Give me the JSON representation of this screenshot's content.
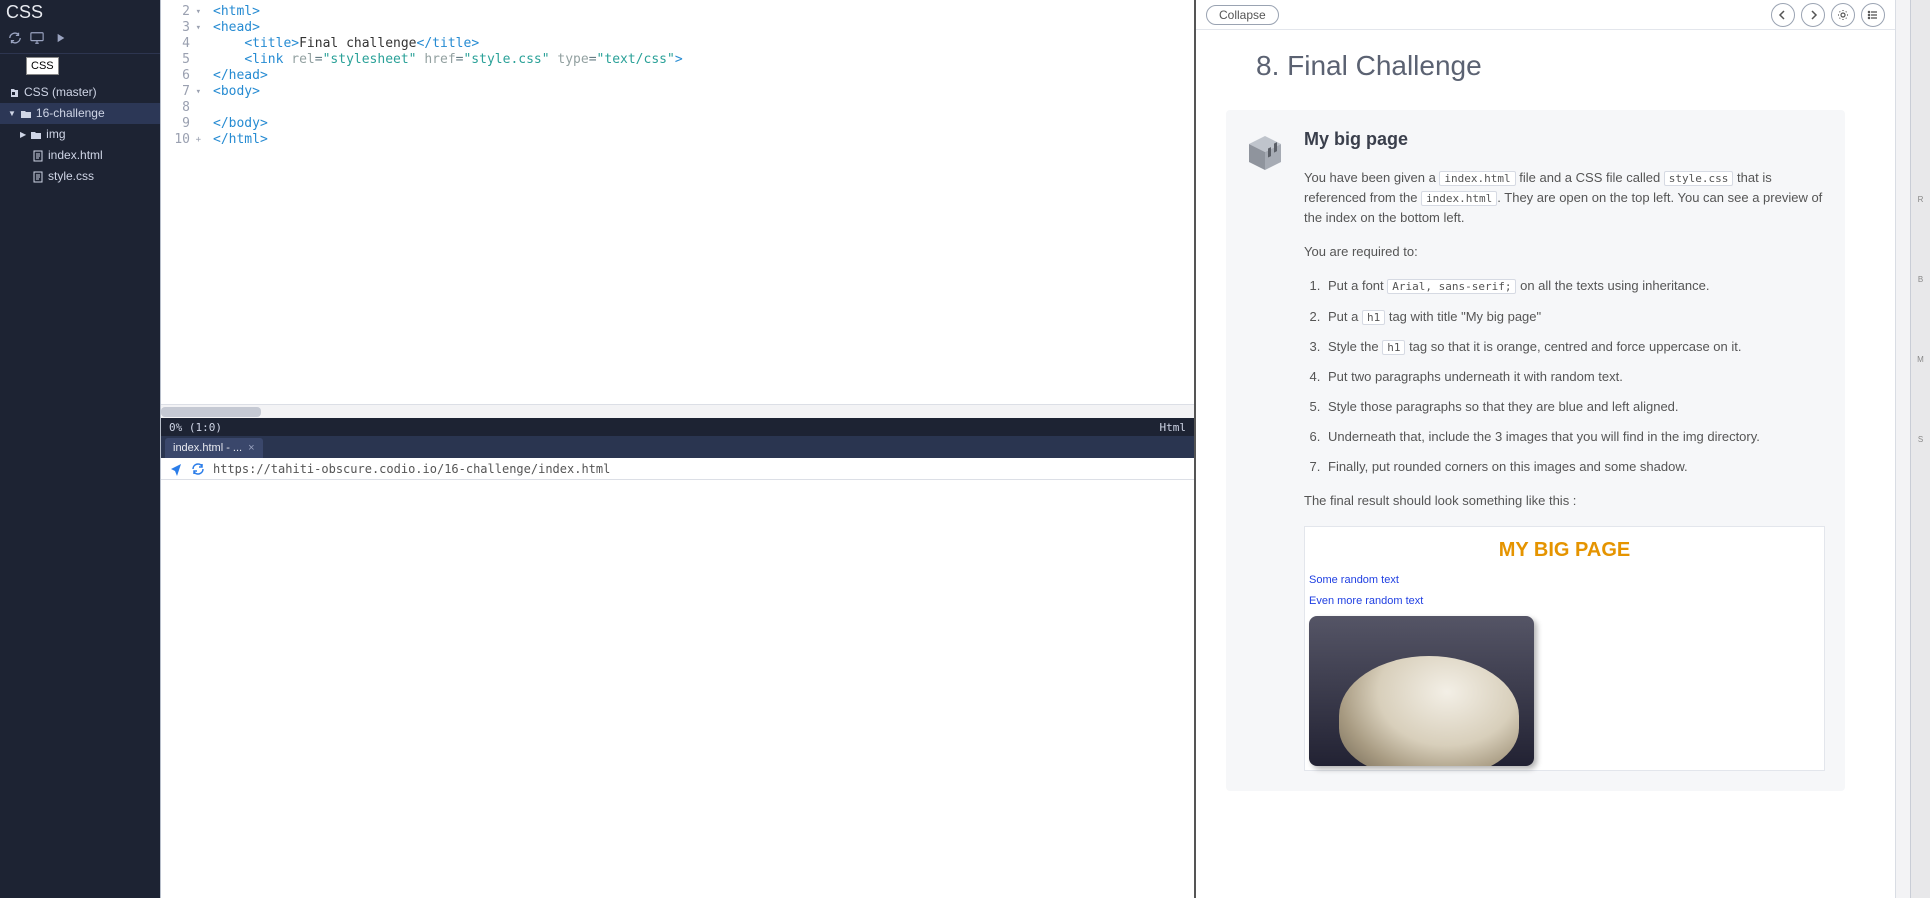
{
  "sidebar": {
    "title": "CSS",
    "tooltip": "CSS",
    "tree": {
      "root_label": "CSS (master)",
      "folder_label": "16-challenge",
      "img_label": "img",
      "index_label": "index.html",
      "style_label": "style.css"
    }
  },
  "editor": {
    "lines": [
      {
        "n": "2",
        "fold": true,
        "html": "<span class='t-punc'>&lt;</span><span class='t-tag'>html</span><span class='t-punc'>&gt;</span>"
      },
      {
        "n": "3",
        "fold": true,
        "html": "<span class='t-punc'>&lt;</span><span class='t-tag'>head</span><span class='t-punc'>&gt;</span>"
      },
      {
        "n": "4",
        "fold": false,
        "html": "    <span class='t-punc'>&lt;</span><span class='t-tag'>title</span><span class='t-punc'>&gt;</span><span class='t-text'>Final challenge</span><span class='t-punc'>&lt;/</span><span class='t-tag'>title</span><span class='t-punc'>&gt;</span>"
      },
      {
        "n": "5",
        "fold": false,
        "html": "    <span class='t-punc'>&lt;</span><span class='t-tag'>link</span> <span class='t-attr'>rel</span><span class='t-eq'>=</span><span class='t-str'>\"stylesheet\"</span> <span class='t-attr'>href</span><span class='t-eq'>=</span><span class='t-str'>\"style.css\"</span> <span class='t-attr'>type</span><span class='t-eq'>=</span><span class='t-str'>\"text/css\"</span><span class='t-punc'>&gt;</span>"
      },
      {
        "n": "6",
        "fold": false,
        "html": "<span class='t-punc'>&lt;/</span><span class='t-tag'>head</span><span class='t-punc'>&gt;</span>"
      },
      {
        "n": "7",
        "fold": true,
        "html": "<span class='t-punc'>&lt;</span><span class='t-tag'>body</span><span class='t-punc'>&gt;</span>"
      },
      {
        "n": "8",
        "fold": false,
        "html": ""
      },
      {
        "n": "9",
        "fold": false,
        "html": "<span class='t-punc'>&lt;/</span><span class='t-tag'>body</span><span class='t-punc'>&gt;</span>"
      },
      {
        "n": "10",
        "fold": false,
        "html": "<span class='t-punc'>&lt;/</span><span class='t-tag'>html</span><span class='t-punc'>&gt;</span>"
      }
    ],
    "status_left": "0%  (1:0)",
    "status_right": "Html"
  },
  "preview": {
    "tab_label": "index.html - ...",
    "url": "https://tahiti-obscure.codio.io/16-challenge/index.html"
  },
  "instructions": {
    "collapse_label": "Collapse",
    "title": "8. Final Challenge",
    "card_title": "My big page",
    "intro_a": "You have been given a ",
    "code_index": "index.html",
    "intro_b": " file and a CSS file called ",
    "code_style": "style.css",
    "intro_c": " that is referenced from the ",
    "intro_d": ". They are open on the top left. You can see a preview of the index on the bottom left.",
    "required_label": "You are required to:",
    "code_font": "Arial, sans-serif;",
    "code_h1": "h1",
    "steps": {
      "s1a": "Put a font ",
      "s1b": " on all the texts using inheritance.",
      "s2a": "Put a ",
      "s2b": " tag with title \"My big page\"",
      "s3a": "Style the ",
      "s3b": " tag so that it is orange, centred and force uppercase on it.",
      "s4": "Put two paragraphs underneath it with random text.",
      "s5": "Style those paragraphs so that they are blue and left aligned.",
      "s6": "Underneath that, include the 3 images that you will find in the img directory.",
      "s7": "Finally, put rounded corners on this images and some shadow."
    },
    "final_label": "The final result should look something like this :",
    "example": {
      "title": "MY BIG PAGE",
      "p1": "Some random text",
      "p2": "Even more random text"
    }
  }
}
